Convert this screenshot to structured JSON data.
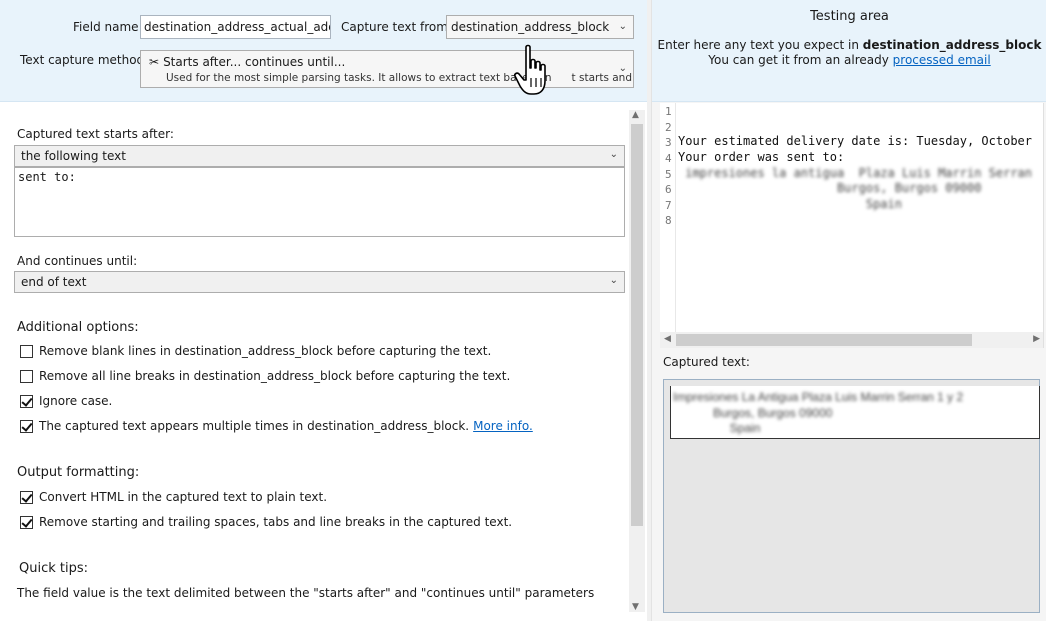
{
  "top": {
    "field_name_label": "Field name",
    "field_name_value": "destination_address_actual_address",
    "capture_from_label": "Capture text from",
    "capture_from_value": "destination_address_block",
    "method_label": "Text capture method",
    "method_title": "Starts after... continues until...",
    "method_desc": "Used for the most simple parsing tasks. It allows to extract text based on",
    "method_desc_tail": "t starts and"
  },
  "left": {
    "starts_after_label": "Captured text starts after:",
    "starts_after_mode": "the following text",
    "starts_after_text": "sent to:",
    "continues_label": "And continues until:",
    "continues_mode": "end of text",
    "additional_head": "Additional options:",
    "options": [
      {
        "label": "Remove blank lines in destination_address_block before capturing the text.",
        "checked": false
      },
      {
        "label": "Remove all line breaks in destination_address_block before capturing the text.",
        "checked": false
      },
      {
        "label": "Ignore case.",
        "checked": true
      },
      {
        "label": "The captured text appears multiple times in destination_address_block.",
        "checked": true,
        "link": "More info."
      }
    ],
    "output_head": "Output formatting:",
    "output_options": [
      {
        "label": "Convert HTML in the captured text to plain text.",
        "checked": true
      },
      {
        "label": "Remove starting and trailing spaces, tabs and line breaks in the captured text.",
        "checked": true
      }
    ],
    "tips_head": "Quick tips:",
    "tips_text": "The field value is the text delimited between the \"starts after\" and \"continues until\" parameters"
  },
  "right": {
    "title": "Testing area",
    "hint_prefix": "Enter here any text you expect in ",
    "hint_bold": "destination_address_block",
    "hint2_prefix": "You can get it from an already ",
    "hint2_link": "processed email",
    "line_numbers": [
      "1",
      "2",
      "3",
      "4",
      "5",
      "6",
      "7",
      "8"
    ],
    "code_lines": [
      "",
      "",
      "Your estimated delivery date is: Tuesday, October",
      "Your order was sent to:",
      " impresiones la antigua  Plaza Luis Marrin Serran",
      "                      Burgos, Burgos 09000",
      "                          Spain",
      ""
    ],
    "captured_label": "Captured text:",
    "captured_lines": [
      "Impresiones La Antigua Plaza Luis Marrin Serran 1 y 2",
      "            Burgos, Burgos 09000",
      "                 Spain"
    ]
  },
  "icons": {
    "method": "scissors-icon",
    "dropdown": "chevron-down-icon",
    "cursor": "hand-pointer-icon"
  }
}
